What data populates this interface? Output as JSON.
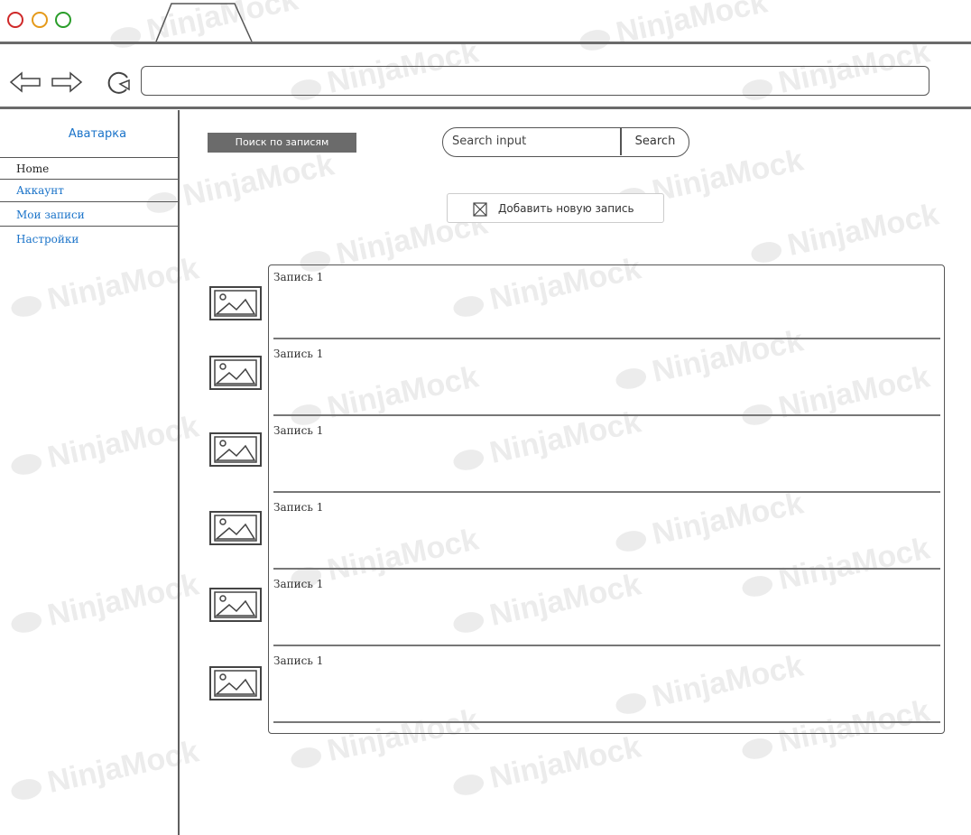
{
  "window": {
    "traffic_lights": [
      {
        "name": "close",
        "color": "#cf2929"
      },
      {
        "name": "minimize",
        "color": "#e59a1a"
      },
      {
        "name": "maximize",
        "color": "#2a9d2a"
      }
    ]
  },
  "navbar": {
    "back_icon": "arrow-left-icon",
    "forward_icon": "arrow-right-icon",
    "reload_icon": "reload-icon",
    "address_value": ""
  },
  "sidebar": {
    "avatar_label": "Аватарка",
    "items": [
      {
        "label": "Home",
        "color": "#222222"
      },
      {
        "label": "Аккаунт",
        "color": "#1a73c9"
      },
      {
        "label": "Мои записи",
        "color": "#1a73c9"
      },
      {
        "label": "Настройки",
        "color": "#1a73c9"
      }
    ]
  },
  "main": {
    "search_label_button": "Поиск по записям",
    "search_placeholder": "Search input",
    "search_button": "Search",
    "add_button": "Добавить новую запись",
    "records": [
      {
        "title": "Запись 1"
      },
      {
        "title": "Запись 1"
      },
      {
        "title": "Запись 1"
      },
      {
        "title": "Запись 1"
      },
      {
        "title": "Запись 1"
      },
      {
        "title": "Запись 1"
      }
    ]
  },
  "watermark": "NinjaMock"
}
